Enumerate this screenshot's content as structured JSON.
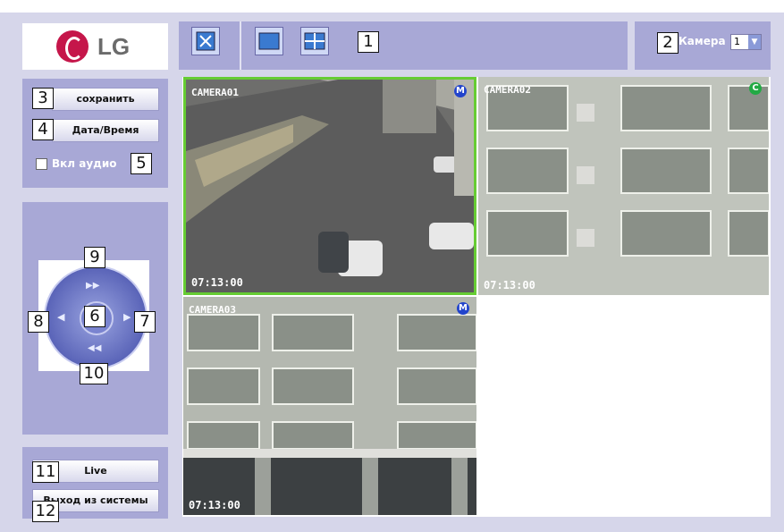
{
  "callouts": [
    "1",
    "2",
    "3",
    "4",
    "5",
    "6",
    "7",
    "8",
    "9",
    "10",
    "11",
    "12"
  ],
  "logo": {
    "text": "LG",
    "brand_color": "#c5164a"
  },
  "toolbar": {
    "icons": [
      "fullscreen-icon",
      "single-view-icon",
      "quad-view-icon"
    ]
  },
  "camera_select": {
    "label": "Камера",
    "value": "1"
  },
  "left_panel": {
    "save_label": "сохранить",
    "datetime_label": "Дата/Время",
    "audio_label": "Вкл аудио",
    "audio_checked": false
  },
  "ptz": {
    "icons": [
      "ptz-up-icon",
      "ptz-left-icon",
      "ptz-center-icon",
      "ptz-right-icon",
      "ptz-down-icon"
    ]
  },
  "bottom_panel": {
    "live_label": "Live",
    "logout_label": "Выход из системы"
  },
  "cameras": [
    {
      "name": "CAMERA01",
      "time": "07:13:00",
      "badge": "M",
      "badge_color": "#2244cc",
      "selected": true
    },
    {
      "name": "CAMERA02",
      "time": "07:13:00",
      "badge": "C",
      "badge_color": "#22aa44",
      "selected": false
    },
    {
      "name": "CAMERA03",
      "time": "07:13:00",
      "badge": "M",
      "badge_color": "#2244cc",
      "selected": false
    }
  ],
  "colors": {
    "frame": "#d6d6ea",
    "panel": "#a8a8d6",
    "selected_border": "#66cc33"
  }
}
